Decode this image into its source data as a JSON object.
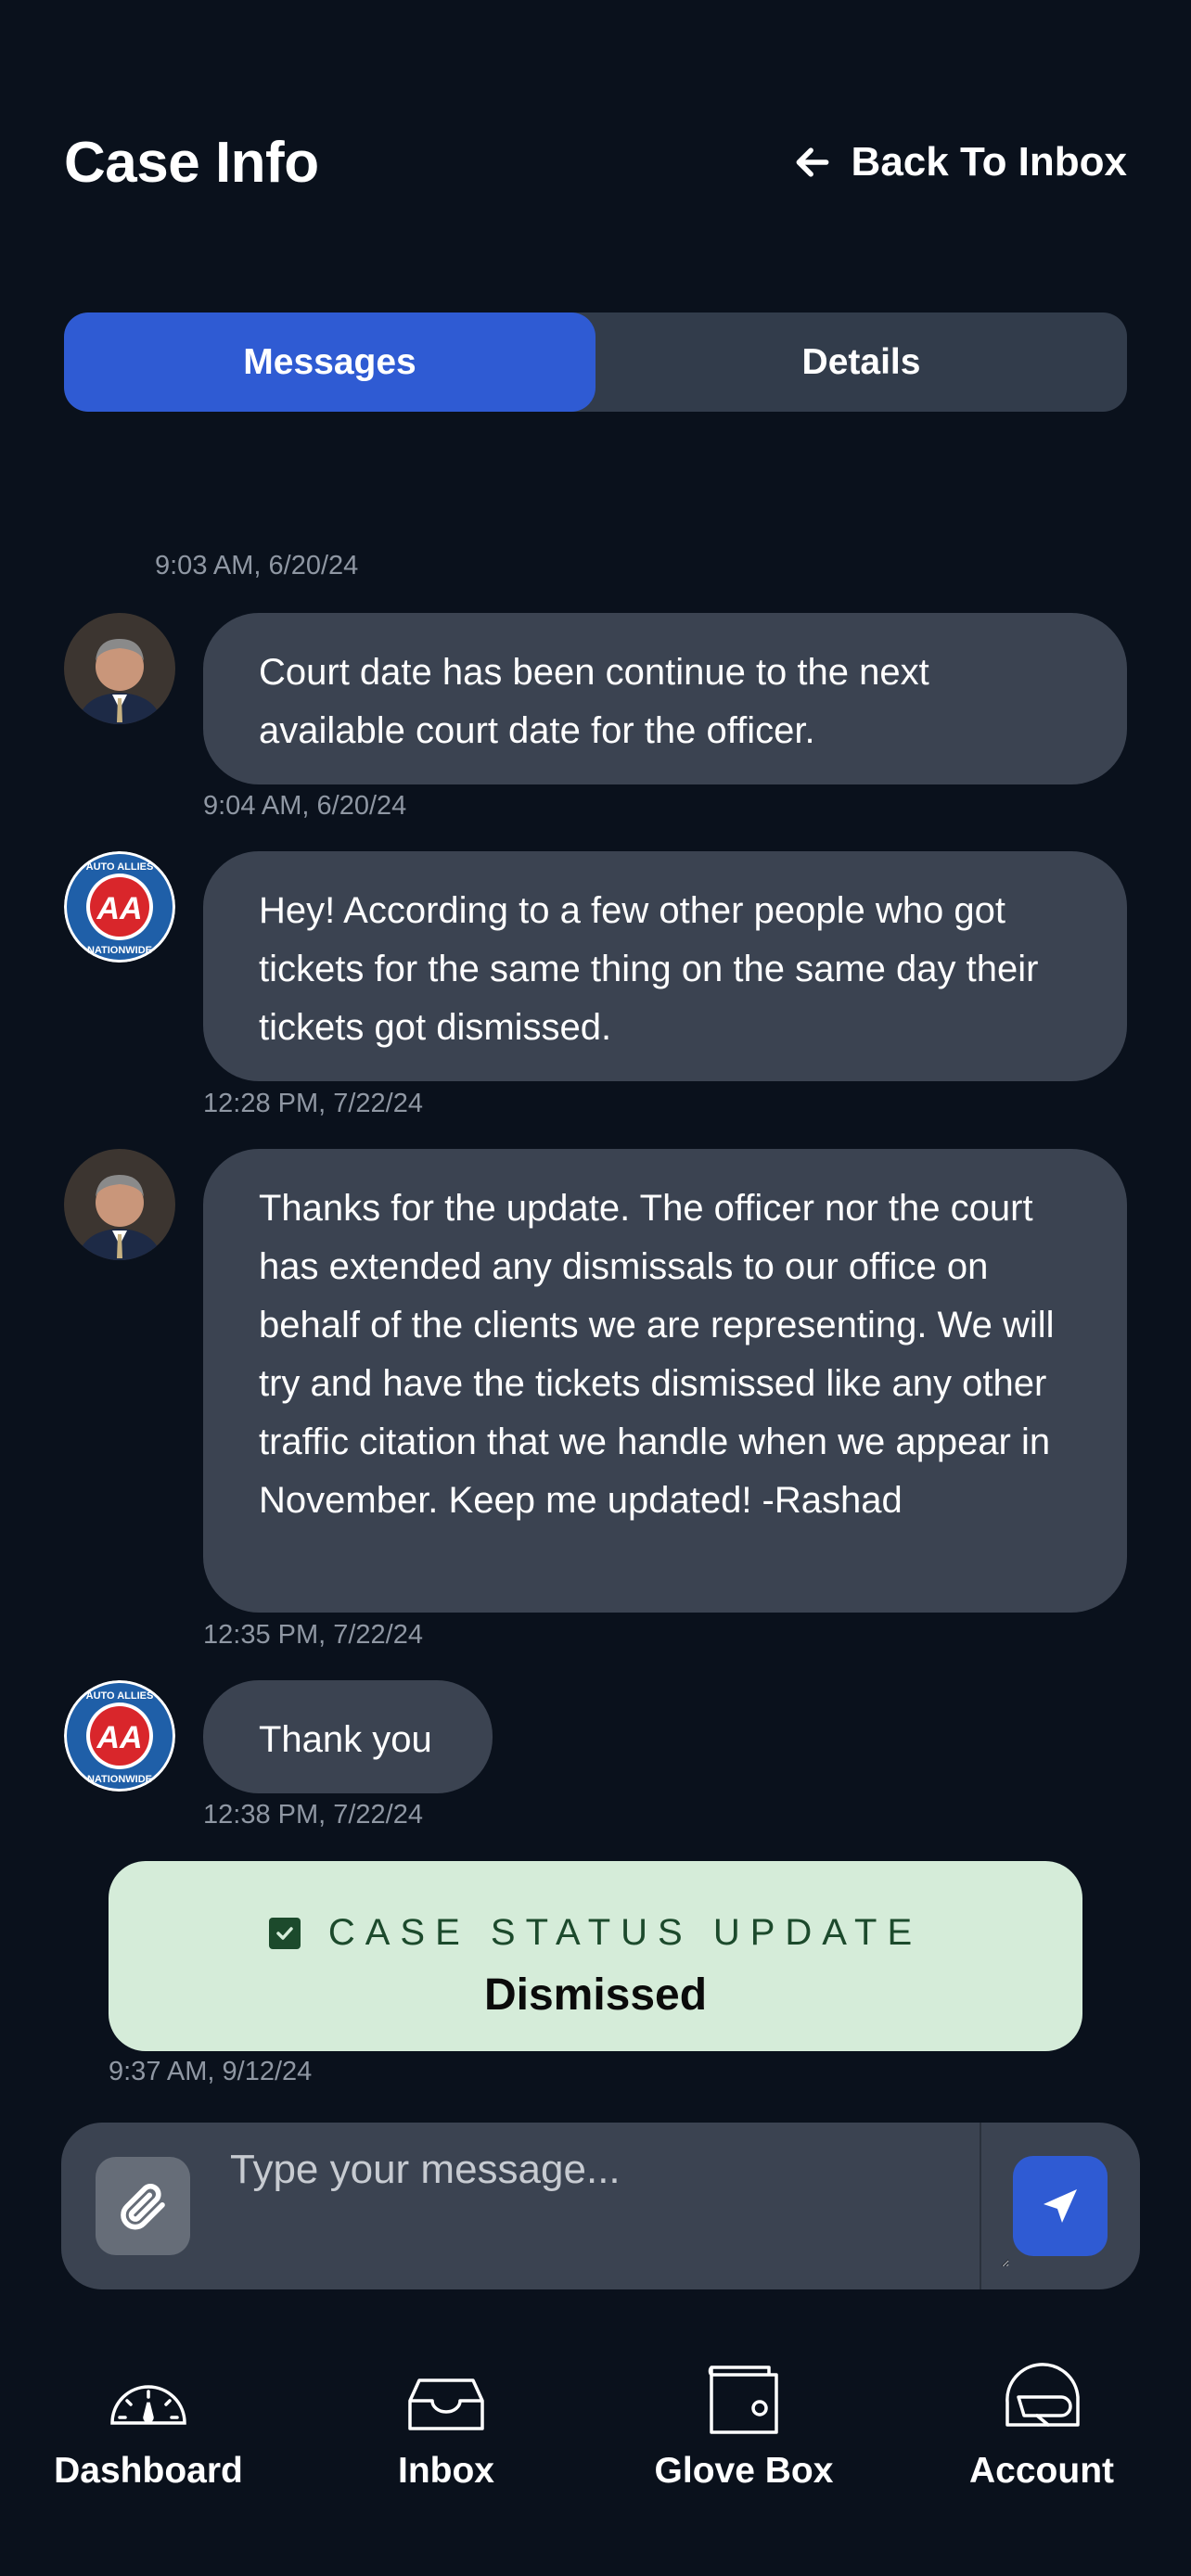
{
  "header": {
    "title": "Case Info",
    "back_label": "Back To Inbox"
  },
  "tabs": [
    {
      "label": "Messages",
      "active": true
    },
    {
      "label": "Details",
      "active": false
    }
  ],
  "messages": [
    {
      "timestamp": "9:03 AM, 6/20/24"
    },
    {
      "sender": "attorney",
      "text": "Court date has been continue to the next available court date for the officer.",
      "timestamp": "9:04 AM, 6/20/24"
    },
    {
      "sender": "client",
      "text": "Hey! According to a few other people who got tickets for the same thing on the same day their tickets got dismissed.",
      "timestamp": "12:28 PM, 7/22/24"
    },
    {
      "sender": "attorney",
      "text": "Thanks for the update. The officer nor the court has extended any dismissals to our office on behalf of the clients we are representing. We will try and have the tickets dismissed like any other traffic citation that we handle when we appear in November. Keep me updated! -Rashad",
      "timestamp": "12:35 PM, 7/22/24"
    },
    {
      "sender": "client",
      "text": "Thank you",
      "timestamp": "12:38 PM, 7/22/24"
    }
  ],
  "status_update": {
    "heading": "CASE STATUS UPDATE",
    "value": "Dismissed",
    "timestamp": "9:37 AM, 9/12/24"
  },
  "composer": {
    "placeholder": "Type your message..."
  },
  "nav": [
    {
      "label": "Dashboard",
      "icon": "gauge-icon"
    },
    {
      "label": "Inbox",
      "icon": "inbox-icon"
    },
    {
      "label": "Glove Box",
      "icon": "wallet-icon"
    },
    {
      "label": "Account",
      "icon": "helmet-icon"
    }
  ],
  "logo": {
    "text_top": "AUTO ALLIES",
    "text_bottom": "NATIONWIDE",
    "monogram": "AA"
  },
  "colors": {
    "background": "#0a111c",
    "accent": "#2f5bd3",
    "bubble": "#3b4351",
    "status_bg": "#d5ecd9",
    "status_text": "#1c4a2c"
  }
}
